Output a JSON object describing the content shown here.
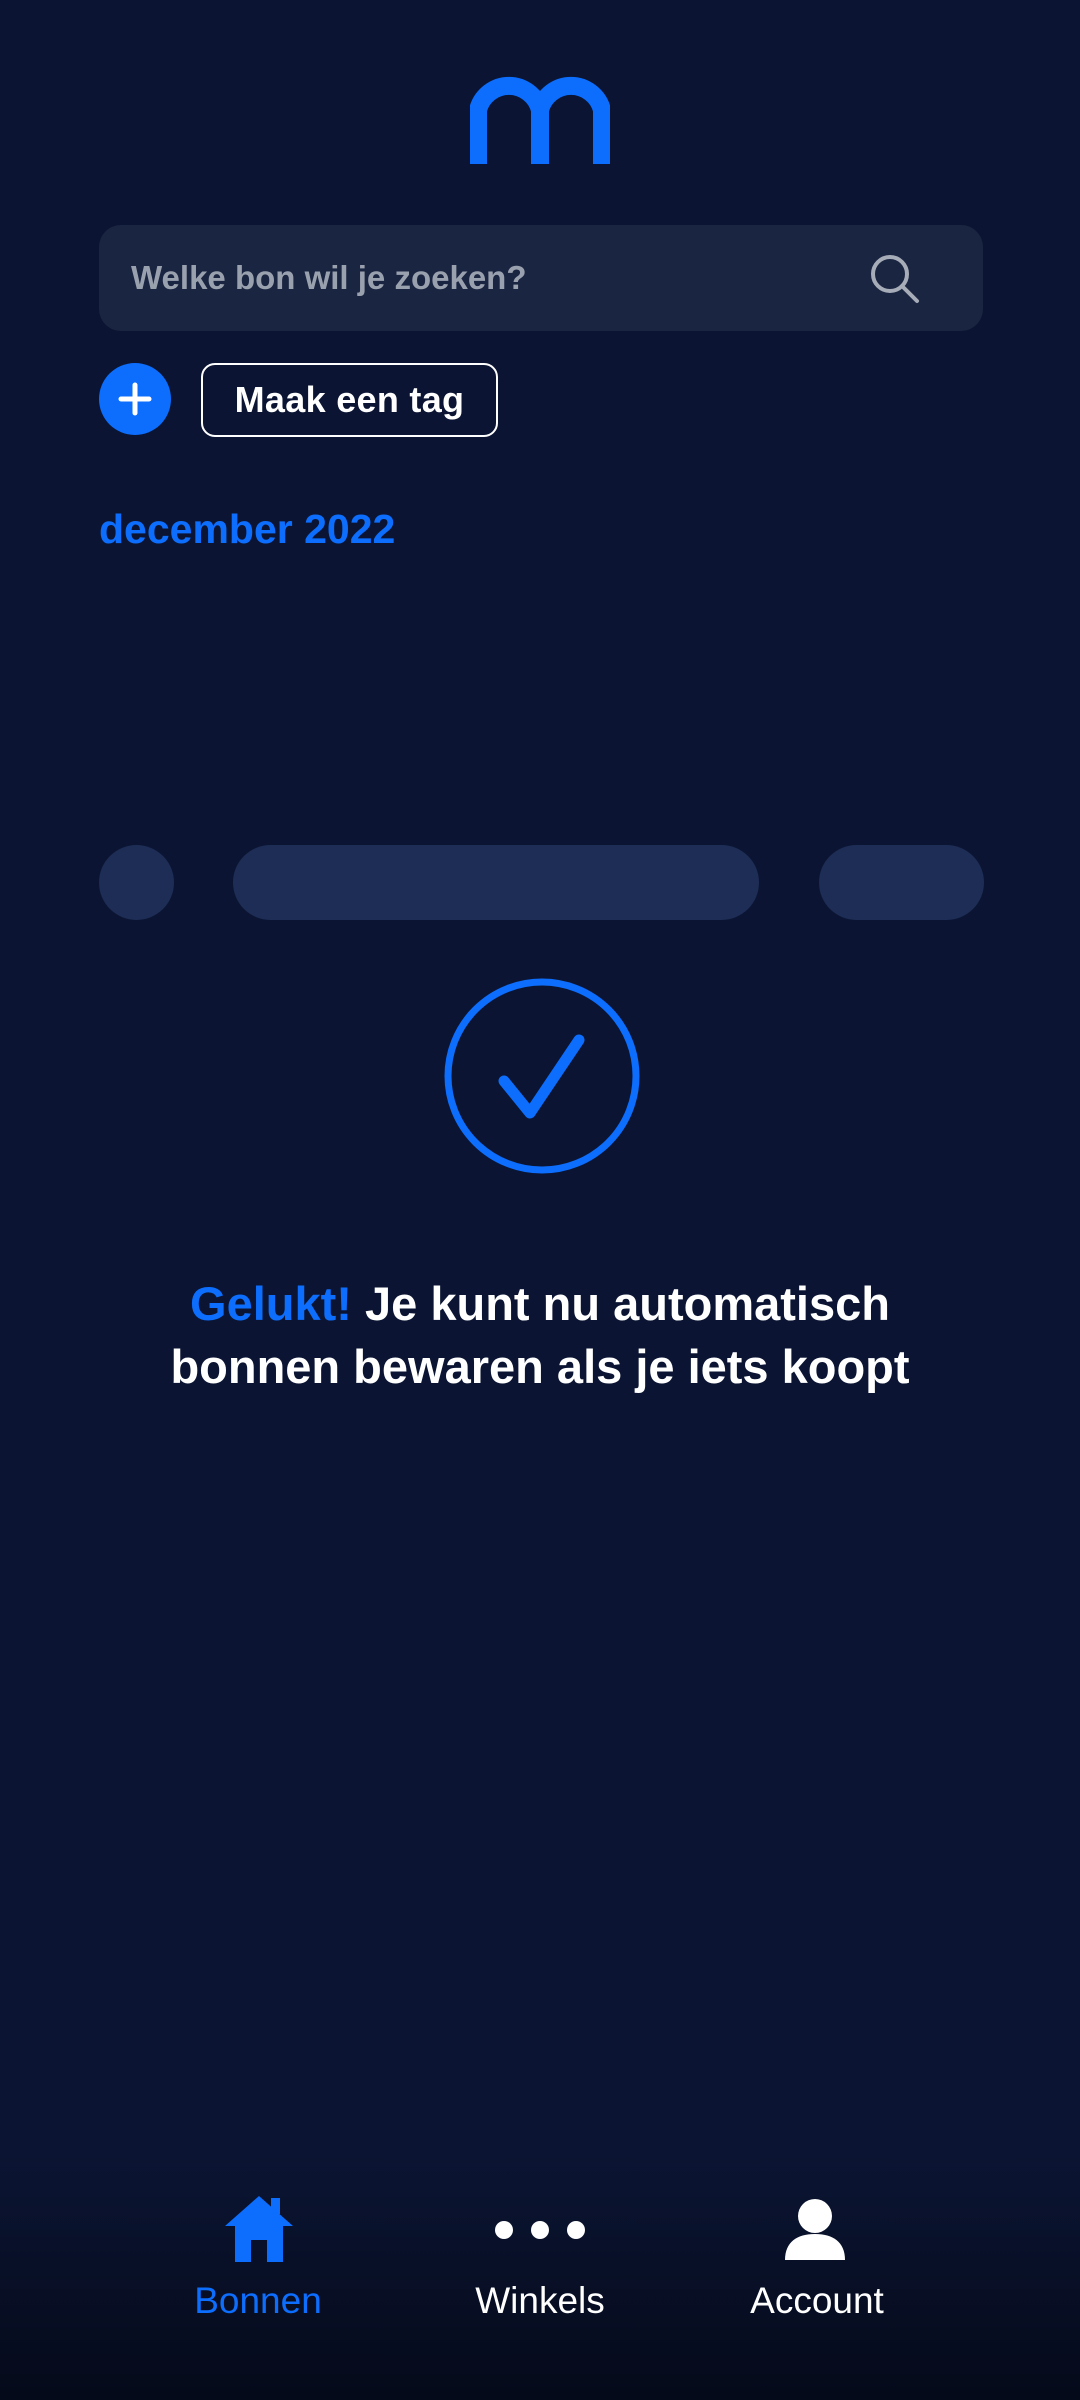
{
  "brand": {
    "logo_icon": "m-logo-icon",
    "accent_color": "#0d6efd",
    "background_color": "#0b1533"
  },
  "search": {
    "placeholder": "Welke bon wil je zoeken?",
    "value": "",
    "icon": "search-icon"
  },
  "actions": {
    "add_icon": "plus-icon",
    "tag_label": "Maak een tag"
  },
  "section": {
    "month_label": "december 2022"
  },
  "success": {
    "icon": "check-circle-icon",
    "highlight": "Gelukt!",
    "line1_rest": " Je kunt nu automatisch",
    "line2": "bonnen bewaren als je iets koopt"
  },
  "bottom_nav": {
    "items": [
      {
        "label": "Bonnen",
        "icon": "home-icon",
        "active": true
      },
      {
        "label": "Winkels",
        "icon": "more-dots-icon",
        "active": false
      },
      {
        "label": "Account",
        "icon": "person-icon",
        "active": false
      }
    ]
  }
}
